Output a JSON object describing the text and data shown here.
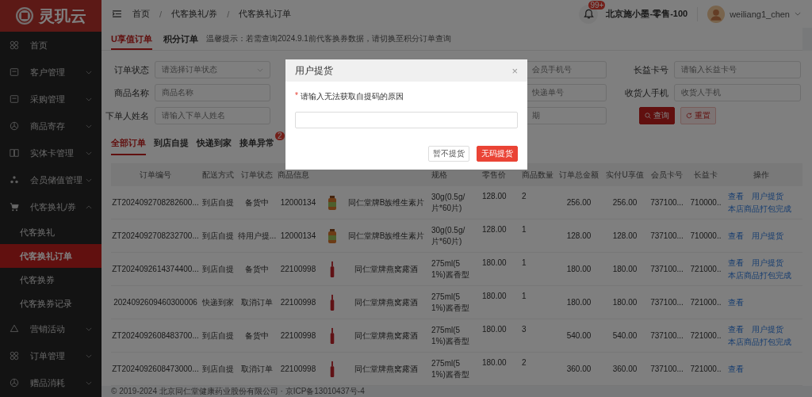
{
  "logo": {
    "text": "灵玑云"
  },
  "sidebar": {
    "items": [
      {
        "label": "首页",
        "kind": "link"
      },
      {
        "label": "客户管理",
        "kind": "group",
        "expanded": false
      },
      {
        "label": "采购管理",
        "kind": "group",
        "expanded": false
      },
      {
        "label": "商品寄存",
        "kind": "group",
        "expanded": false
      },
      {
        "label": "实体卡管理",
        "kind": "group",
        "expanded": false
      },
      {
        "label": "会员储值管理",
        "kind": "group",
        "expanded": false
      },
      {
        "label": "代客换礼/券",
        "kind": "group",
        "expanded": true,
        "children": [
          {
            "label": "代客换礼",
            "selected": false
          },
          {
            "label": "代客换礼订单",
            "selected": true
          },
          {
            "label": "代客换券",
            "selected": false
          },
          {
            "label": "代客换券记录",
            "selected": false
          }
        ]
      },
      {
        "label": "营销活动",
        "kind": "group",
        "expanded": false
      },
      {
        "label": "订单管理",
        "kind": "group",
        "expanded": false
      },
      {
        "label": "赠品消耗",
        "kind": "group",
        "expanded": false
      }
    ]
  },
  "topbar": {
    "breadcrumb": [
      "首页",
      "代客换礼/券",
      "代客换礼订单"
    ],
    "separator": "/",
    "notification_badge": "99+",
    "store": "北京施小墨-零售-100",
    "user": "weiliang1_chen"
  },
  "page_tabs": [
    {
      "label": "U享值订单",
      "selected": true
    },
    {
      "label": "积分订单",
      "selected": false
    }
  ],
  "tip": "温馨提示：若需查询2024.9.1前代客换券数据，请切换至积分订单查询",
  "filters": {
    "rows": [
      {
        "left": {
          "label": "订单状态",
          "placeholder": "请选择订单状态",
          "kind": "select"
        },
        "middle": {
          "placeholder": "会员手机号"
        },
        "right": {
          "label": "长益卡号",
          "placeholder": "请输入长益卡号"
        }
      },
      {
        "left": {
          "label": "商品名称",
          "placeholder": "商品名称",
          "kind": "text"
        },
        "middle": {
          "placeholder": "快递单号"
        },
        "right": {
          "label": "收货人手机",
          "placeholder": "收货人手机"
        }
      },
      {
        "left": {
          "label": "下单人姓名",
          "placeholder": "请输入下单人姓名",
          "kind": "text"
        },
        "middle": {
          "placeholder": "期"
        }
      }
    ],
    "search_button": "查询",
    "reset_button": "重置"
  },
  "order_tabs": [
    {
      "label": "全部订单",
      "selected": true
    },
    {
      "label": "到店自提",
      "selected": false
    },
    {
      "label": "快递到家",
      "selected": false
    },
    {
      "label": "接单异常",
      "selected": false,
      "badge": "2"
    }
  ],
  "table": {
    "columns": [
      "订单编号",
      "配送方式",
      "订单状态",
      "商品信息",
      "规格",
      "零售价",
      "商品数量",
      "订单总金额",
      "实付U享值",
      "会员卡号",
      "长益卡",
      "操作"
    ],
    "rows": [
      {
        "order_no": "ZT2024092708282600...",
        "delivery": "到店自提",
        "status": "备货中",
        "code": "12000134",
        "kind": "jar",
        "product": "同仁堂牌B族维生素片",
        "spec": "30g(0.5g/片*60片)",
        "price": "128.00",
        "qty": "2",
        "total": "256.00",
        "paid": "256.00",
        "member_card": "737100...",
        "card": "710000..",
        "actions": [
          "查看",
          "用户提货",
          "本店商品打包完成"
        ]
      },
      {
        "order_no": "ZT2024092708232700...",
        "delivery": "到店自提",
        "status": "待用户提...",
        "code": "12000134",
        "kind": "jar",
        "product": "同仁堂牌B族维生素片",
        "spec": "30g(0.5g/片*60片)",
        "price": "128.00",
        "qty": "1",
        "total": "128.00",
        "paid": "128.00",
        "member_card": "737100...",
        "card": "710000..",
        "actions": [
          "查看",
          "用户提货"
        ]
      },
      {
        "order_no": "ZT2024092614374400...",
        "delivery": "到店自提",
        "status": "备货中",
        "code": "22100998",
        "kind": "bottle",
        "product": "同仁堂牌燕窝露酒",
        "spec": "275ml(51%)酱香型",
        "price": "180.00",
        "qty": "1",
        "total": "180.00",
        "paid": "180.00",
        "member_card": "737100...",
        "card": "721000..",
        "actions": [
          "查看",
          "用户提货",
          "本店商品打包完成"
        ]
      },
      {
        "order_no": "2024092609460300006",
        "delivery": "快递到家",
        "status": "取消订单",
        "code": "22100998",
        "kind": "bottle",
        "product": "同仁堂牌燕窝露酒",
        "spec": "275ml(51%)酱香型",
        "price": "180.00",
        "qty": "1",
        "total": "180.00",
        "paid": "180.00",
        "member_card": "737100...",
        "card": "721000..",
        "actions": [
          "查看"
        ]
      },
      {
        "order_no": "ZT2024092608483700...",
        "delivery": "到店自提",
        "status": "备货中",
        "code": "22100998",
        "kind": "bottle",
        "product": "同仁堂牌燕窝露酒",
        "spec": "275ml(51%)酱香型",
        "price": "180.00",
        "qty": "3",
        "total": "540.00",
        "paid": "540.00",
        "member_card": "737100...",
        "card": "721000..",
        "actions": [
          "查看",
          "用户提货",
          "本店商品打包完成"
        ]
      },
      {
        "order_no": "ZT2024092608473000...",
        "delivery": "到店自提",
        "status": "取消订单",
        "code": "22100998",
        "kind": "bottle",
        "product": "同仁堂牌燕窝露酒",
        "spec": "275ml(51%)酱香型",
        "price": "180.00",
        "qty": "2",
        "total": "360.00",
        "paid": "360.00",
        "member_card": "737100...",
        "card": "721000..",
        "actions": [
          "查看"
        ]
      }
    ]
  },
  "footer": "© 2019-2024 北京同仁堂健康药业股份有限公司 · 京ICP备13010437号-4",
  "modal": {
    "title": "用户提货",
    "close": "×",
    "required_mark": "*",
    "label": "请输入无法获取自提码的原因",
    "buttons": [
      {
        "label": "暂不提货",
        "kind": "default"
      },
      {
        "label": "无码提货",
        "kind": "primary"
      }
    ]
  }
}
